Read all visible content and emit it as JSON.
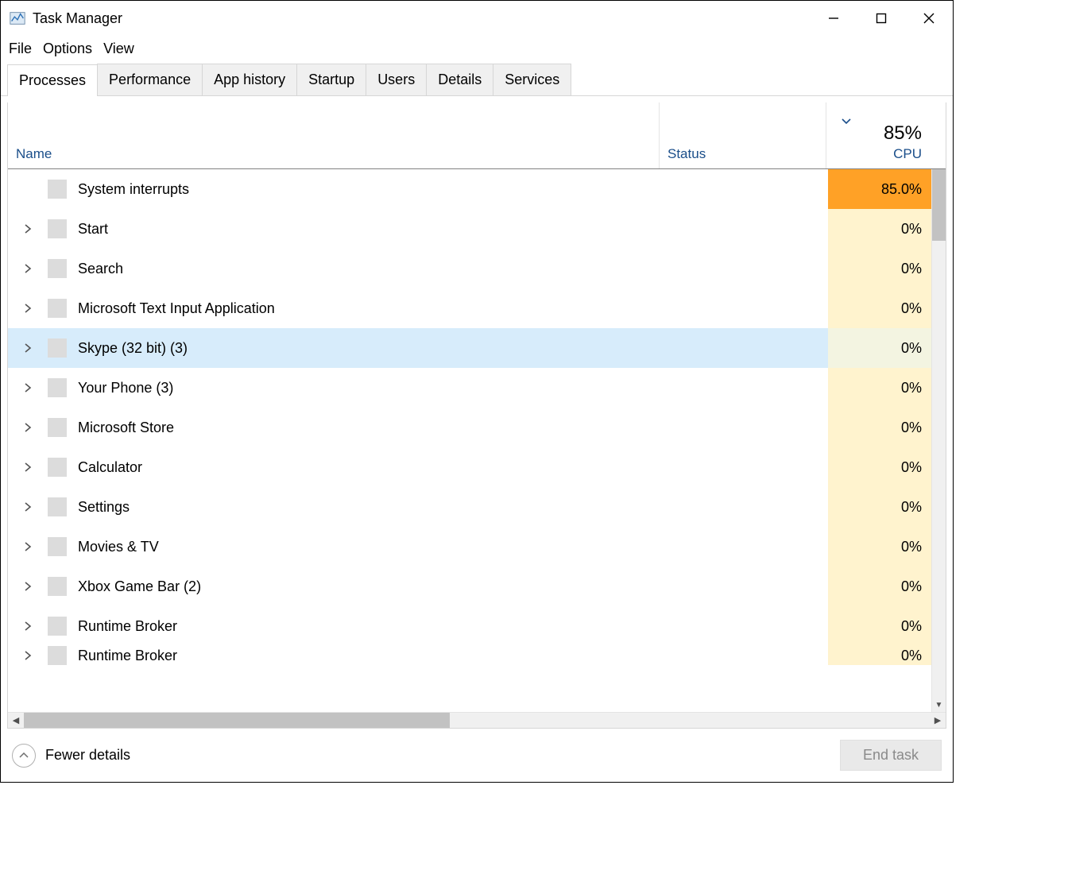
{
  "window": {
    "title": "Task Manager"
  },
  "menubar": [
    "File",
    "Options",
    "View"
  ],
  "tabs": [
    "Processes",
    "Performance",
    "App history",
    "Startup",
    "Users",
    "Details",
    "Services"
  ],
  "active_tab": 0,
  "columns": {
    "name": "Name",
    "status": "Status",
    "cpu_label": "CPU",
    "cpu_total": "85%"
  },
  "processes": [
    {
      "name": "System interrupts",
      "cpu": "85.0%",
      "expandable": false,
      "hot": true
    },
    {
      "name": "Start",
      "cpu": "0%",
      "expandable": true
    },
    {
      "name": "Search",
      "cpu": "0%",
      "expandable": true
    },
    {
      "name": "Microsoft Text Input Application",
      "cpu": "0%",
      "expandable": true
    },
    {
      "name": "Skype (32 bit) (3)",
      "cpu": "0%",
      "expandable": true,
      "selected": true
    },
    {
      "name": "Your Phone (3)",
      "cpu": "0%",
      "expandable": true
    },
    {
      "name": "Microsoft Store",
      "cpu": "0%",
      "expandable": true
    },
    {
      "name": "Calculator",
      "cpu": "0%",
      "expandable": true
    },
    {
      "name": "Settings",
      "cpu": "0%",
      "expandable": true
    },
    {
      "name": "Movies & TV",
      "cpu": "0%",
      "expandable": true
    },
    {
      "name": "Xbox Game Bar (2)",
      "cpu": "0%",
      "expandable": true
    },
    {
      "name": "Runtime Broker",
      "cpu": "0%",
      "expandable": true
    },
    {
      "name": "Runtime Broker",
      "cpu": "0%",
      "expandable": true,
      "partial": true
    }
  ],
  "footer": {
    "fewer_details": "Fewer details",
    "end_task": "End task"
  }
}
